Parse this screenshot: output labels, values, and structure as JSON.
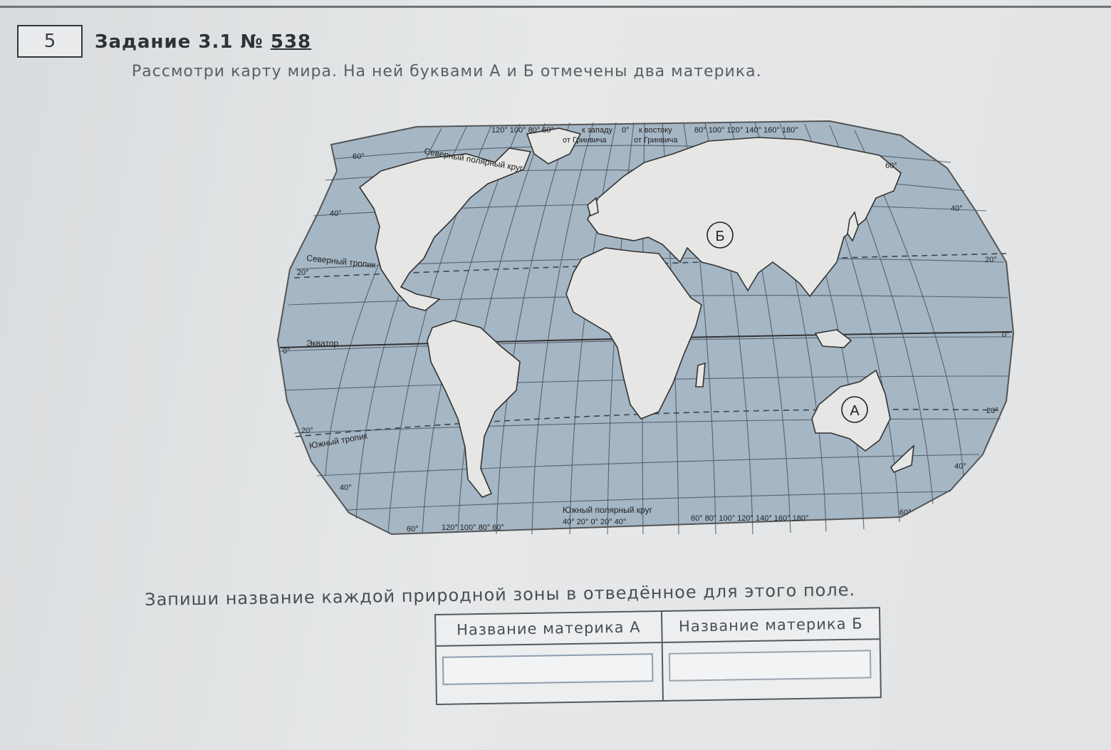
{
  "task": {
    "number": "5",
    "title_prefix": "Задание 3.1 № ",
    "title_id": "538",
    "prompt": "Рассмотри карту мира. На ней буквами А и Б отмечены два материка.",
    "instruction": "Запиши название каждой природной зоны в отведённое для этого поле."
  },
  "map": {
    "ocean_color": "#a5b6c4",
    "land_color": "#e6e6e4",
    "lines": {
      "north_circle": "Северный полярный круг",
      "north_tropic": "Северный тропик",
      "equator": "Экватор",
      "south_tropic": "Южный тропик",
      "south_circle": "Южный полярный круг"
    },
    "top_scale": {
      "west": "120° 100° 80° 60°",
      "to_west": "к западу",
      "zero": "0°",
      "to_east": "к востоку",
      "from_west": "от Гринвича",
      "from_east": "от Гринвича",
      "east": "80° 100° 120° 140° 160° 180°"
    },
    "bottom_scale": {
      "left": "60°",
      "west": "120° 100° 80° 60°",
      "middle": "40° 20° 0° 20° 40°",
      "east": "60° 80° 100° 120° 140° 160° 180°",
      "right": "60°"
    },
    "lat_labels_left": {
      "n60": "60°",
      "n40": "40°",
      "n20": "20°",
      "eq": "0°",
      "s20": "20°",
      "s40": "40°"
    },
    "lat_labels_right": {
      "n60": "60°",
      "n40": "40°",
      "n20": "20°",
      "eq": "0°",
      "s20": "20°",
      "s40": "40°"
    },
    "markers": {
      "a": "А",
      "b": "Б"
    }
  },
  "answer_table": {
    "col_a_header": "Название материка А",
    "col_b_header": "Название материка Б",
    "col_a_value": "",
    "col_b_value": ""
  }
}
